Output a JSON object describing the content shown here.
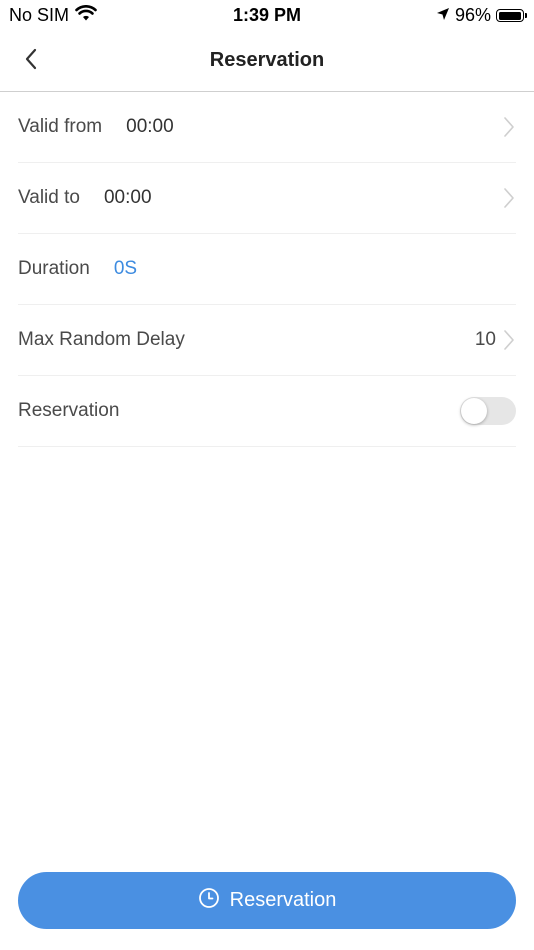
{
  "status_bar": {
    "carrier": "No SIM",
    "time": "1:39 PM",
    "battery_percent": "96%",
    "battery_level": 0.96,
    "icons": [
      "wifi-icon",
      "location-arrow-icon",
      "battery-icon"
    ]
  },
  "nav": {
    "title": "Reservation",
    "back_icon": "chevron-left-icon"
  },
  "rows": [
    {
      "label": "Valid from",
      "value": "00:00",
      "has_chevron": true
    },
    {
      "label": "Valid to",
      "value": "00:00",
      "has_chevron": true
    },
    {
      "label": "Duration",
      "value": "0S",
      "value_color": "#3d8be0"
    },
    {
      "label": "Max Random Delay",
      "right_value": "10",
      "has_chevron": true
    },
    {
      "label": "Reservation",
      "toggle_on": false
    }
  ],
  "primary_button": {
    "label": "Reservation",
    "icon": "clock-icon",
    "color": "#4a90e2"
  },
  "colors": {
    "accent": "#4a90e2",
    "link_value": "#3d8be0"
  }
}
